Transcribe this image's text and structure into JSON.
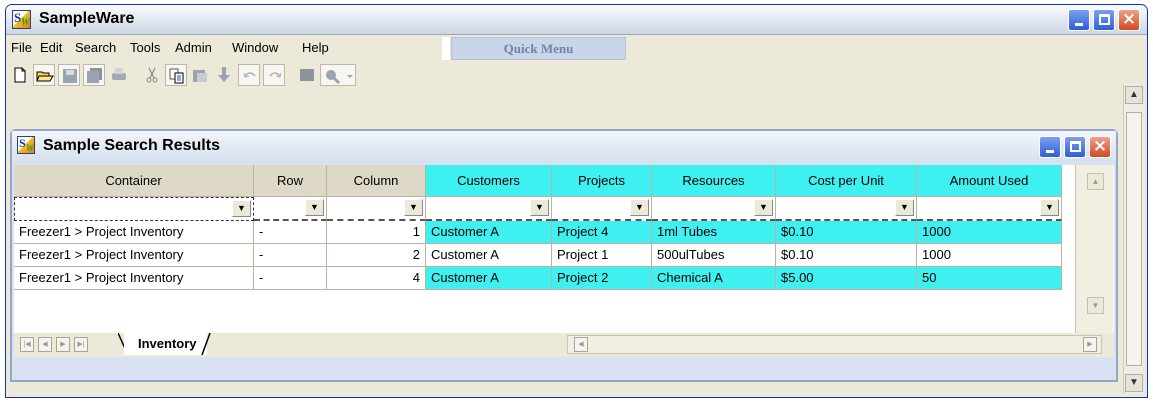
{
  "app": {
    "title": "SampleWare",
    "logo_letters": "SW",
    "logo_main": "S",
    "logo_sub": "W"
  },
  "menu": {
    "items": [
      "File",
      "Edit",
      "Search",
      "Tools",
      "Admin",
      "Window",
      "Help"
    ],
    "quick_menu": "Quick Menu"
  },
  "toolbar": {
    "icons": [
      "new-document-icon",
      "open-folder-icon",
      "save-icon",
      "save-all-icon",
      "print-icon",
      "cut-icon",
      "copy-icon",
      "paste-icon",
      "import-icon",
      "undo-icon",
      "redo-icon",
      "color-block-icon",
      "search-dropdown-icon"
    ]
  },
  "child_window": {
    "title": "Sample Search Results"
  },
  "grid": {
    "columns": [
      "Container",
      "Row",
      "Column",
      "Customers",
      "Projects",
      "Resources",
      "Cost per Unit",
      "Amount Used"
    ],
    "rows": [
      [
        "Freezer1 > Project Inventory",
        "-",
        "1",
        "Customer A",
        "Project 4",
        "1ml Tubes",
        "$0.10",
        "1000"
      ],
      [
        "Freezer1 > Project Inventory",
        "-",
        "2",
        "Customer A",
        "Project 1",
        "500ulTubes",
        "$0.10",
        "1000"
      ],
      [
        "Freezer1 > Project Inventory",
        "-",
        "4",
        "Customer A",
        "Project 2",
        "Chemical A",
        "$5.00",
        "50"
      ]
    ]
  },
  "tabs": {
    "active": "Inventory"
  },
  "colors": {
    "highlight": "#3ff0f0",
    "title_blue": "#0831d9"
  }
}
